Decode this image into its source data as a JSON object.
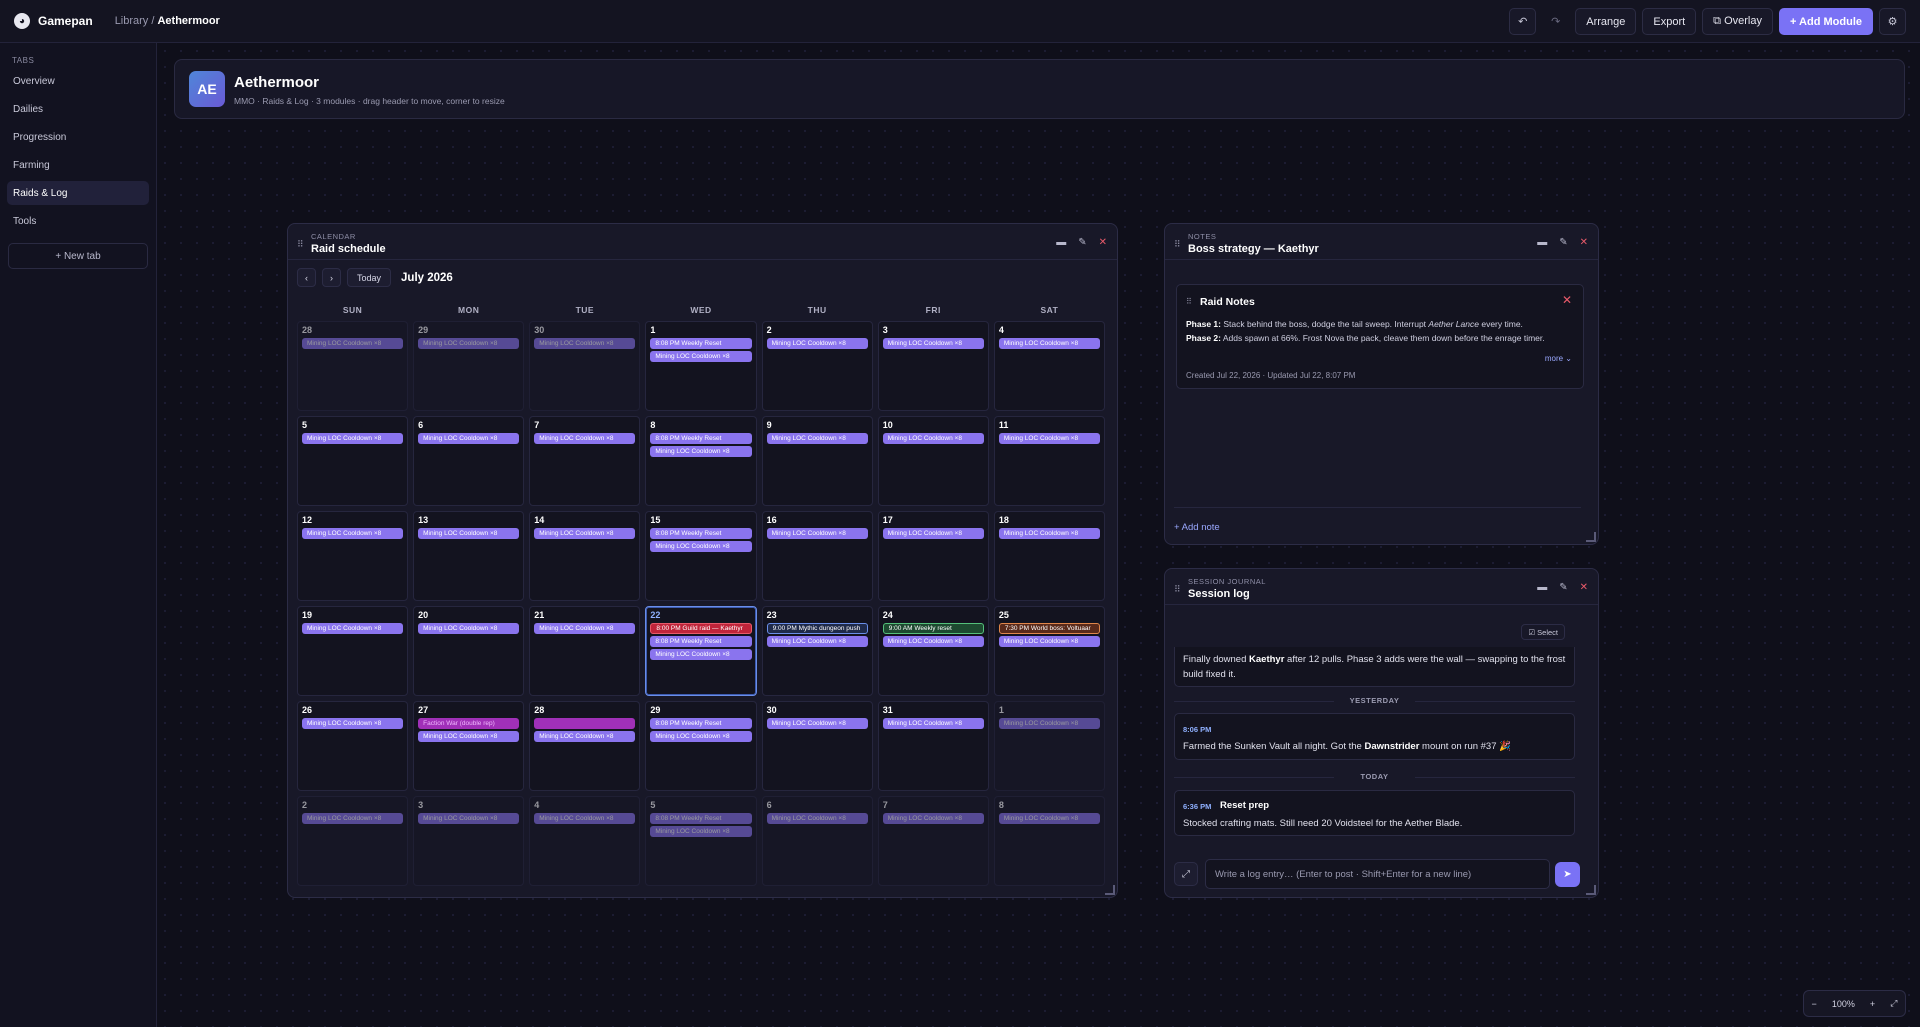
{
  "topbar": {
    "brand": "Gamepan",
    "crumb_library": "Library",
    "crumb_sep": " / ",
    "crumb_current": "Aethermoor",
    "undo": "↶",
    "redo": "↷",
    "arrange": "Arrange",
    "export": "Export",
    "overlay": "⧉ Overlay",
    "add_module": "+ Add Module",
    "settings": "⚙"
  },
  "sidebar": {
    "section_label": "TABS",
    "items": [
      "Overview",
      "Dailies",
      "Progression",
      "Farming",
      "Raids & Log",
      "Tools"
    ],
    "active_index": 4,
    "new_tab": "+ New tab"
  },
  "header_card": {
    "avatar": "AE",
    "title": "Aethermoor",
    "subtitle": "MMO · Raids & Log · 3 modules · drag header to move, corner to resize"
  },
  "calendar": {
    "kicker": "CALENDAR",
    "title": "Raid schedule",
    "prev": "‹",
    "next": "›",
    "today": "Today",
    "month": "July 2026",
    "weekdays": [
      "SUN",
      "MON",
      "TUE",
      "WED",
      "THU",
      "FRI",
      "SAT"
    ],
    "weeks": [
      [
        {
          "d": "28",
          "other": true,
          "ev": [
            [
              "purple",
              "Mining LOC Cooldown ×8"
            ]
          ]
        },
        {
          "d": "29",
          "other": true,
          "ev": [
            [
              "purple",
              "Mining LOC Cooldown ×8"
            ]
          ]
        },
        {
          "d": "30",
          "other": true,
          "ev": [
            [
              "purple",
              "Mining LOC Cooldown ×8"
            ]
          ]
        },
        {
          "d": "1",
          "ev": [
            [
              "purple",
              "8:08 PM Weekly Reset"
            ],
            [
              "purple",
              "Mining LOC Cooldown ×8"
            ]
          ]
        },
        {
          "d": "2",
          "ev": [
            [
              "purple",
              "Mining LOC Cooldown ×8"
            ]
          ]
        },
        {
          "d": "3",
          "ev": [
            [
              "purple",
              "Mining LOC Cooldown ×8"
            ]
          ]
        },
        {
          "d": "4",
          "ev": [
            [
              "purple",
              "Mining LOC Cooldown ×8"
            ]
          ]
        }
      ],
      [
        {
          "d": "5",
          "ev": [
            [
              "purple",
              "Mining LOC Cooldown ×8"
            ]
          ]
        },
        {
          "d": "6",
          "ev": [
            [
              "purple",
              "Mining LOC Cooldown ×8"
            ]
          ]
        },
        {
          "d": "7",
          "ev": [
            [
              "purple",
              "Mining LOC Cooldown ×8"
            ]
          ]
        },
        {
          "d": "8",
          "ev": [
            [
              "purple",
              "8:08 PM Weekly Reset"
            ],
            [
              "purple",
              "Mining LOC Cooldown ×8"
            ]
          ]
        },
        {
          "d": "9",
          "ev": [
            [
              "purple",
              "Mining LOC Cooldown ×8"
            ]
          ]
        },
        {
          "d": "10",
          "ev": [
            [
              "purple",
              "Mining LOC Cooldown ×8"
            ]
          ]
        },
        {
          "d": "11",
          "ev": [
            [
              "purple",
              "Mining LOC Cooldown ×8"
            ]
          ]
        }
      ],
      [
        {
          "d": "12",
          "ev": [
            [
              "purple",
              "Mining LOC Cooldown ×8"
            ]
          ]
        },
        {
          "d": "13",
          "ev": [
            [
              "purple",
              "Mining LOC Cooldown ×8"
            ]
          ]
        },
        {
          "d": "14",
          "ev": [
            [
              "purple",
              "Mining LOC Cooldown ×8"
            ]
          ]
        },
        {
          "d": "15",
          "ev": [
            [
              "purple",
              "8:08 PM Weekly Reset"
            ],
            [
              "purple",
              "Mining LOC Cooldown ×8"
            ]
          ]
        },
        {
          "d": "16",
          "ev": [
            [
              "purple",
              "Mining LOC Cooldown ×8"
            ]
          ]
        },
        {
          "d": "17",
          "ev": [
            [
              "purple",
              "Mining LOC Cooldown ×8"
            ]
          ]
        },
        {
          "d": "18",
          "ev": [
            [
              "purple",
              "Mining LOC Cooldown ×8"
            ]
          ]
        }
      ],
      [
        {
          "d": "19",
          "ev": [
            [
              "purple",
              "Mining LOC Cooldown ×8"
            ]
          ]
        },
        {
          "d": "20",
          "ev": [
            [
              "purple",
              "Mining LOC Cooldown ×8"
            ]
          ]
        },
        {
          "d": "21",
          "ev": [
            [
              "purple",
              "Mining LOC Cooldown ×8"
            ]
          ]
        },
        {
          "d": "22",
          "today": true,
          "ev": [
            [
              "raid",
              "8:00 PM Guild raid — Kaethyr"
            ],
            [
              "purple",
              "8:08 PM Weekly Reset"
            ],
            [
              "purple",
              "Mining LOC Cooldown ×8"
            ]
          ]
        },
        {
          "d": "23",
          "ev": [
            [
              "mythic",
              "9:00 PM Mythic dungeon push"
            ],
            [
              "purple",
              "Mining LOC Cooldown ×8"
            ]
          ]
        },
        {
          "d": "24",
          "ev": [
            [
              "weekly",
              "9:00 AM Weekly reset"
            ],
            [
              "purple",
              "Mining LOC Cooldown ×8"
            ]
          ]
        },
        {
          "d": "25",
          "ev": [
            [
              "boss",
              "7:30 PM World boss: Voltuaar"
            ],
            [
              "purple",
              "Mining LOC Cooldown ×8"
            ]
          ]
        }
      ],
      [
        {
          "d": "26",
          "ev": [
            [
              "purple",
              "Mining LOC Cooldown ×8"
            ]
          ]
        },
        {
          "d": "27",
          "ev": [
            [
              "faction",
              "Faction War (double rep)"
            ],
            [
              "purple",
              "Mining LOC Cooldown ×8"
            ]
          ]
        },
        {
          "d": "28",
          "ev": [
            [
              "faction",
              ""
            ],
            [
              "purple",
              "Mining LOC Cooldown ×8"
            ]
          ]
        },
        {
          "d": "29",
          "ev": [
            [
              "purple",
              "8:08 PM Weekly Reset"
            ],
            [
              "purple",
              "Mining LOC Cooldown ×8"
            ]
          ]
        },
        {
          "d": "30",
          "ev": [
            [
              "purple",
              "Mining LOC Cooldown ×8"
            ]
          ]
        },
        {
          "d": "31",
          "ev": [
            [
              "purple",
              "Mining LOC Cooldown ×8"
            ]
          ]
        },
        {
          "d": "1",
          "other": true,
          "ev": [
            [
              "purple",
              "Mining LOC Cooldown ×8"
            ]
          ]
        }
      ],
      [
        {
          "d": "2",
          "other": true,
          "ev": [
            [
              "purple",
              "Mining LOC Cooldown ×8"
            ]
          ]
        },
        {
          "d": "3",
          "other": true,
          "ev": [
            [
              "purple",
              "Mining LOC Cooldown ×8"
            ]
          ]
        },
        {
          "d": "4",
          "other": true,
          "ev": [
            [
              "purple",
              "Mining LOC Cooldown ×8"
            ]
          ]
        },
        {
          "d": "5",
          "other": true,
          "ev": [
            [
              "purple",
              "8:08 PM Weekly Reset"
            ],
            [
              "purple",
              "Mining LOC Cooldown ×8"
            ]
          ]
        },
        {
          "d": "6",
          "other": true,
          "ev": [
            [
              "purple",
              "Mining LOC Cooldown ×8"
            ]
          ]
        },
        {
          "d": "7",
          "other": true,
          "ev": [
            [
              "purple",
              "Mining LOC Cooldown ×8"
            ]
          ]
        },
        {
          "d": "8",
          "other": true,
          "ev": [
            [
              "purple",
              "Mining LOC Cooldown ×8"
            ]
          ]
        }
      ]
    ]
  },
  "notes": {
    "kicker": "NOTES",
    "title": "Boss strategy — Kaethyr",
    "card_title": "Raid Notes",
    "phase1_label": "Phase 1:",
    "phase1_a": " Stack behind the boss, dodge the tail sweep. Interrupt ",
    "phase1_em": "Aether Lance",
    "phase1_b": " every time.",
    "phase2_label": "Phase 2:",
    "phase2_text": " Adds spawn at 66%. Frost Nova the pack, cleave them down before the enrage timer.",
    "more": "more ⌄",
    "meta": "Created Jul 22, 2026 · Updated Jul 22, 8:07 PM",
    "add_note": "+ Add note"
  },
  "journal": {
    "kicker": "SESSION JOURNAL",
    "title": "Session log",
    "select": "☑ Select",
    "entry1_a": "Finally downed ",
    "entry1_b": "Kaethyr",
    "entry1_c": " after 12 pulls. Phase 3 adds were the wall — swapping to the frost build fixed it.",
    "sep_yesterday": "YESTERDAY",
    "entry2_time": "8:06 PM",
    "entry2_a": "Farmed the Sunken Vault all night. Got the ",
    "entry2_b": "Dawnstrider",
    "entry2_c": " mount on run #37 🎉",
    "sep_today": "TODAY",
    "entry3_time": "6:36 PM",
    "entry3_title": "Reset prep",
    "entry3_text": "Stocked crafting mats. Still need 20 Voidsteel for the Aether Blade.",
    "expand": "⤢",
    "placeholder": "Write a log entry… (Enter to post · Shift+Enter for a new line)",
    "send": "➤"
  },
  "zoom": {
    "minus": "−",
    "level": "100%",
    "plus": "+",
    "fit": "⤢"
  }
}
